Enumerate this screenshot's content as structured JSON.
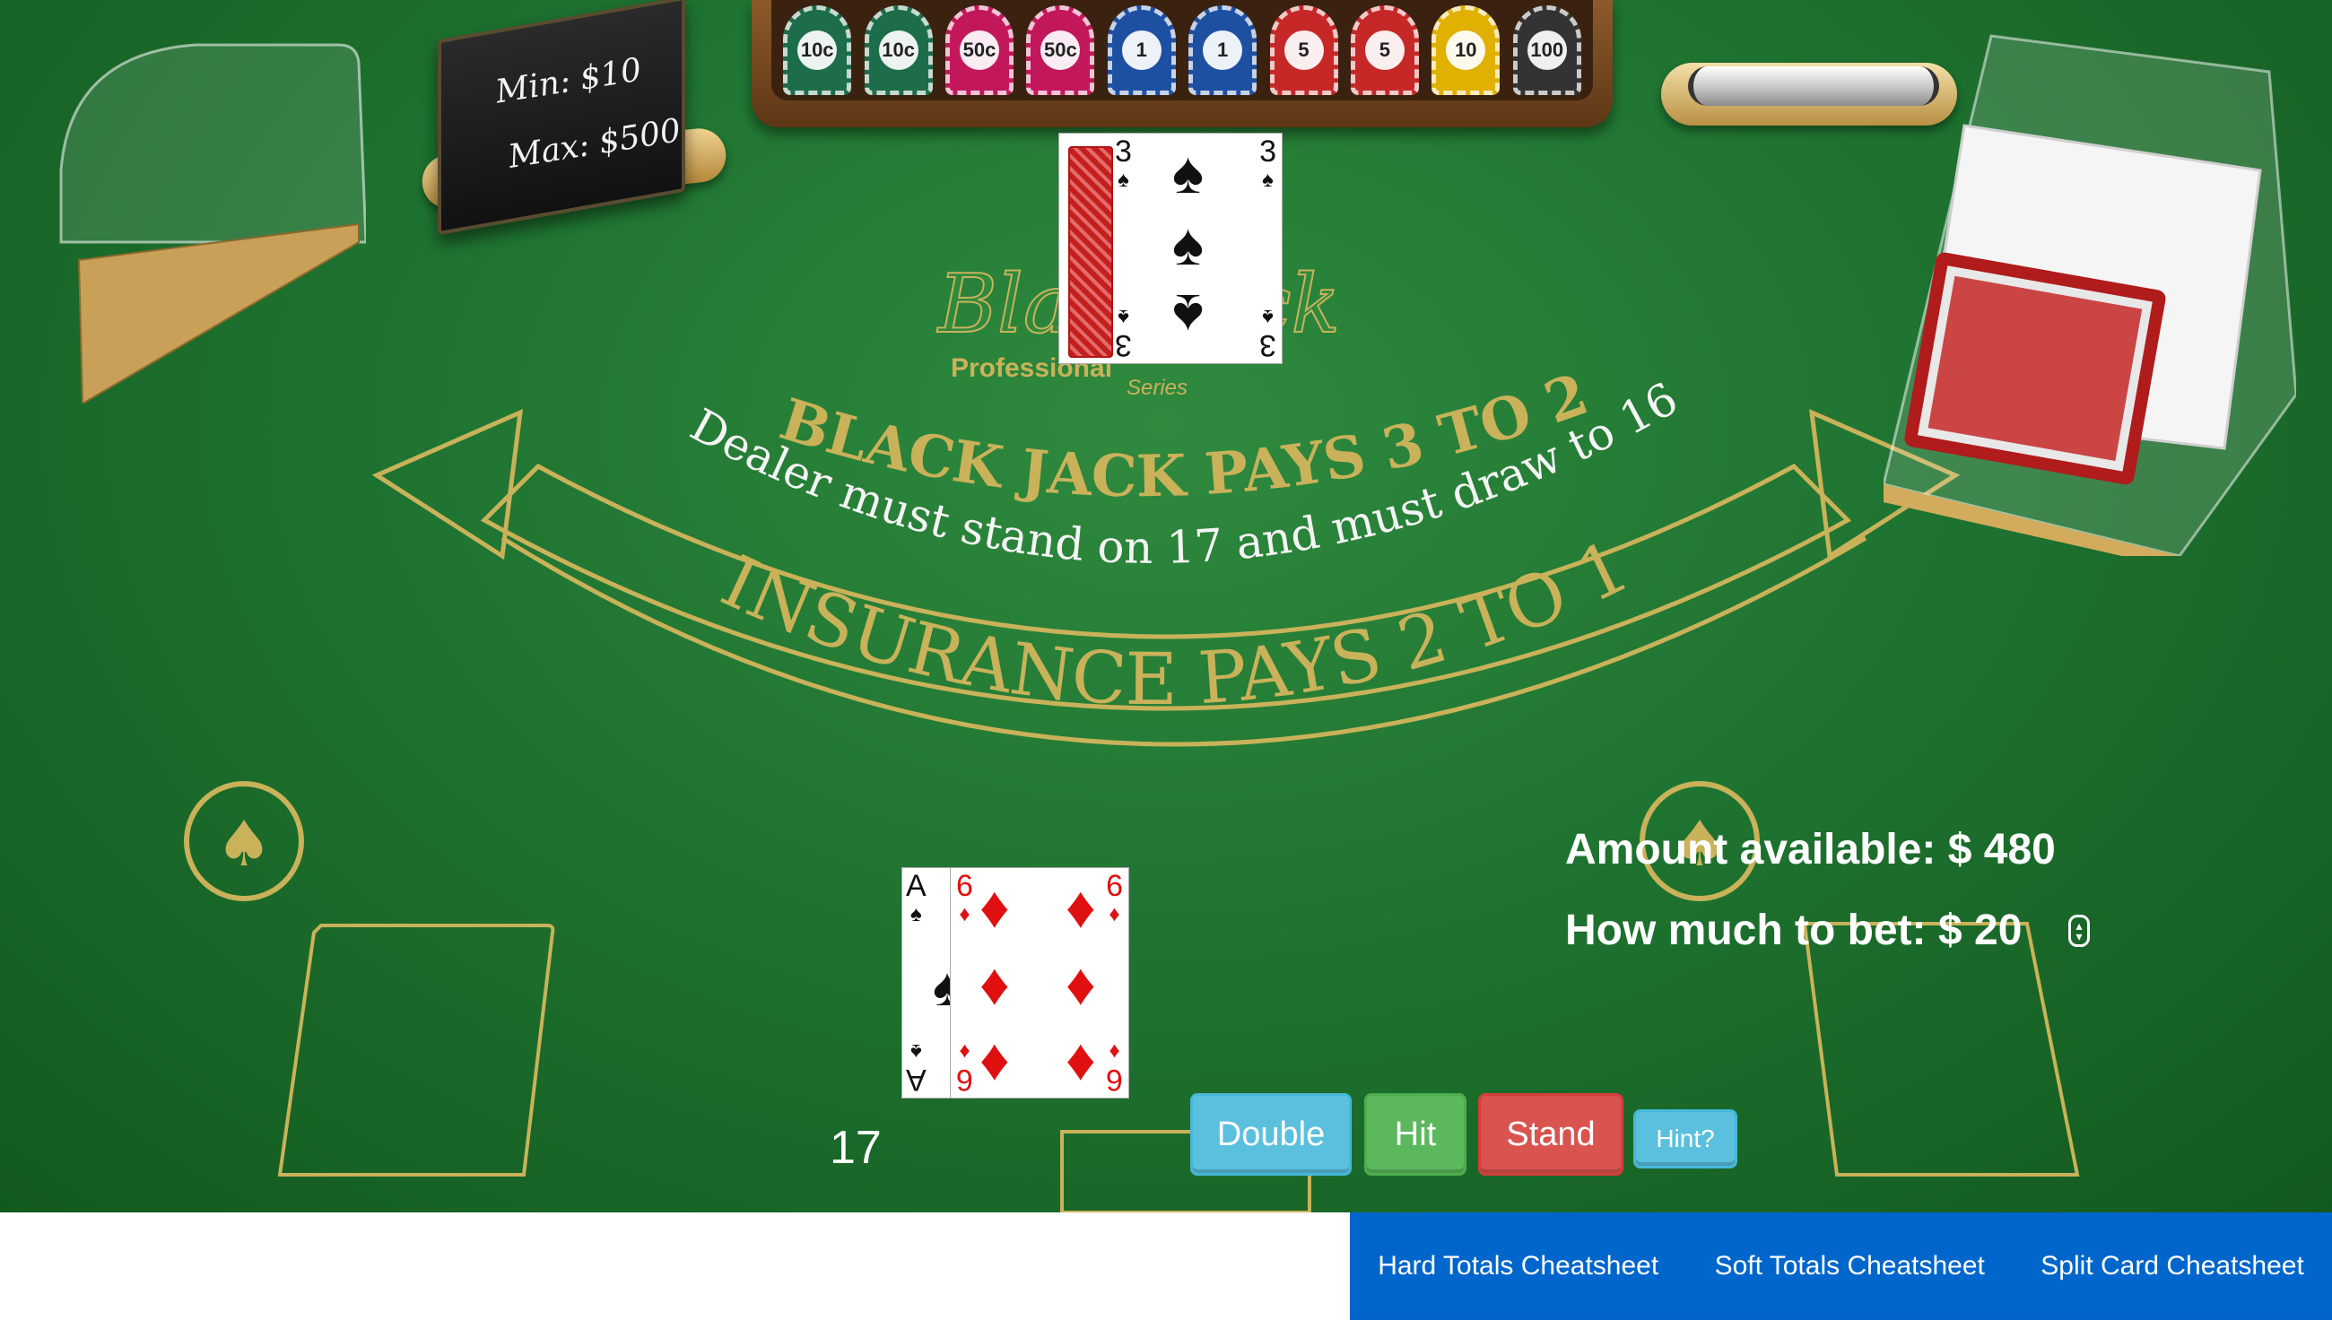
{
  "table": {
    "limits": {
      "min": "Min: $10",
      "max": "Max: $500"
    },
    "chips": [
      "10c",
      "10c",
      "50c",
      "50c",
      "1",
      "1",
      "5",
      "5",
      "10",
      "100"
    ],
    "chip_colors": [
      "#1d6d4a",
      "#1d6d4a",
      "#c2185b",
      "#c2185b",
      "#1e50a2",
      "#1e50a2",
      "#c62828",
      "#c62828",
      "#e0b100",
      "#333333"
    ],
    "felt_logo": "BlackJack",
    "felt_logo_sub1": "Professional",
    "felt_logo_sub2": "Series",
    "felt_line1": "BLACK JACK PAYS 3 TO 2",
    "felt_line2": "Dealer must stand on 17 and must draw to 16",
    "felt_line3": "INSURANCE PAYS 2 TO 1"
  },
  "dealer": {
    "card": {
      "rank": "3",
      "suit": "♠"
    }
  },
  "player": {
    "cards": [
      {
        "rank": "A",
        "suit": "♠"
      },
      {
        "rank": "6",
        "suit": "♦"
      }
    ],
    "total": "17"
  },
  "bankroll": {
    "amount_label": "Amount available: $ 480",
    "bet_label": "How much to bet: $ 20"
  },
  "actions": {
    "double": "Double",
    "hit": "Hit",
    "stand": "Stand",
    "hint": "Hint?"
  },
  "nav": {
    "hard": "Hard Totals Cheatsheet",
    "soft": "Soft Totals Cheatsheet",
    "split": "Split Card Cheatsheet"
  },
  "colors": {
    "felt": "#1f7431",
    "felt_print": "#c9b25a",
    "nav_bg": "#0066cc",
    "double": "#5bc0de",
    "hit": "#5cb85c",
    "stand": "#d9534f"
  }
}
